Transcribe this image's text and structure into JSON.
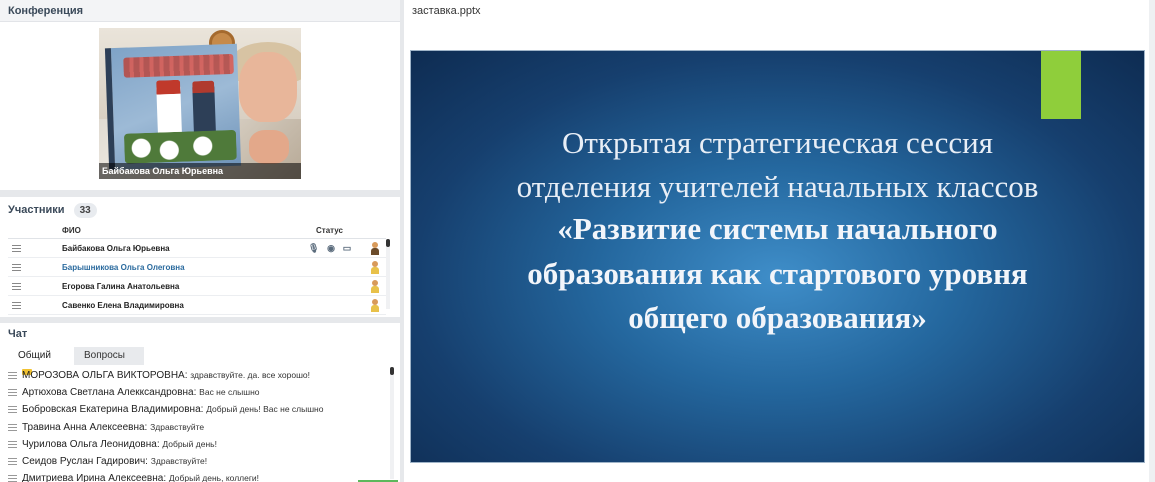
{
  "conference": {
    "title": "Конференция",
    "video_caption": "Байбакова Ольга Юрьевна"
  },
  "participants": {
    "title": "Участники",
    "count": "33",
    "columns": {
      "name": "ФИО",
      "status": "Статус"
    },
    "rows": [
      {
        "name": "Байбакова Ольга Юрьевна",
        "active": false
      },
      {
        "name": "Барышникова Ольга  Олеговна",
        "active": true
      },
      {
        "name": "Егорова  Галина  Анатольевна",
        "active": false
      },
      {
        "name": "Савенко  Елена  Владимировна",
        "active": false
      }
    ]
  },
  "chat": {
    "title": "Чат",
    "tabs": {
      "general": "Общий",
      "questions": "Вопросы"
    },
    "messages": [
      {
        "author": "МОРОЗОВА ОЛЬГА  ВИКТОРОВНА:",
        "text": "здравствуйте. да. все хорошо!"
      },
      {
        "author": "Артюхова Светлана  Алекксандровна:",
        "text": "Вас не слышно"
      },
      {
        "author": "Бобровская Екатерина  Владимировна:",
        "text": "Добрый день! Вас не слышно"
      },
      {
        "author": "Травина  Анна  Алексеевна:",
        "text": "Здравствуйте"
      },
      {
        "author": "Чурилова Ольга Леонидовна:",
        "text": "Добрый день!"
      },
      {
        "author": "Сеидов  Руслан   Гадирович:",
        "text": "Здравствуйте!"
      },
      {
        "author": "Дмитриева  Ирина  Алексеевна:",
        "text": "Добрый день, коллеги!"
      }
    ]
  },
  "presentation": {
    "filename": "заставка.pptx",
    "slide": {
      "line1": "Открытая стратегическая сессия",
      "line2": "отделения учителей начальных классов",
      "bold1": "«Развитие системы начального",
      "bold2": "образования как стартового уровня",
      "bold3": "общего образования»"
    }
  },
  "colors": {
    "slide_accent": "#8fce3b",
    "slide_background": "#1f5a8f",
    "active_participant": "#2a6a9e"
  }
}
